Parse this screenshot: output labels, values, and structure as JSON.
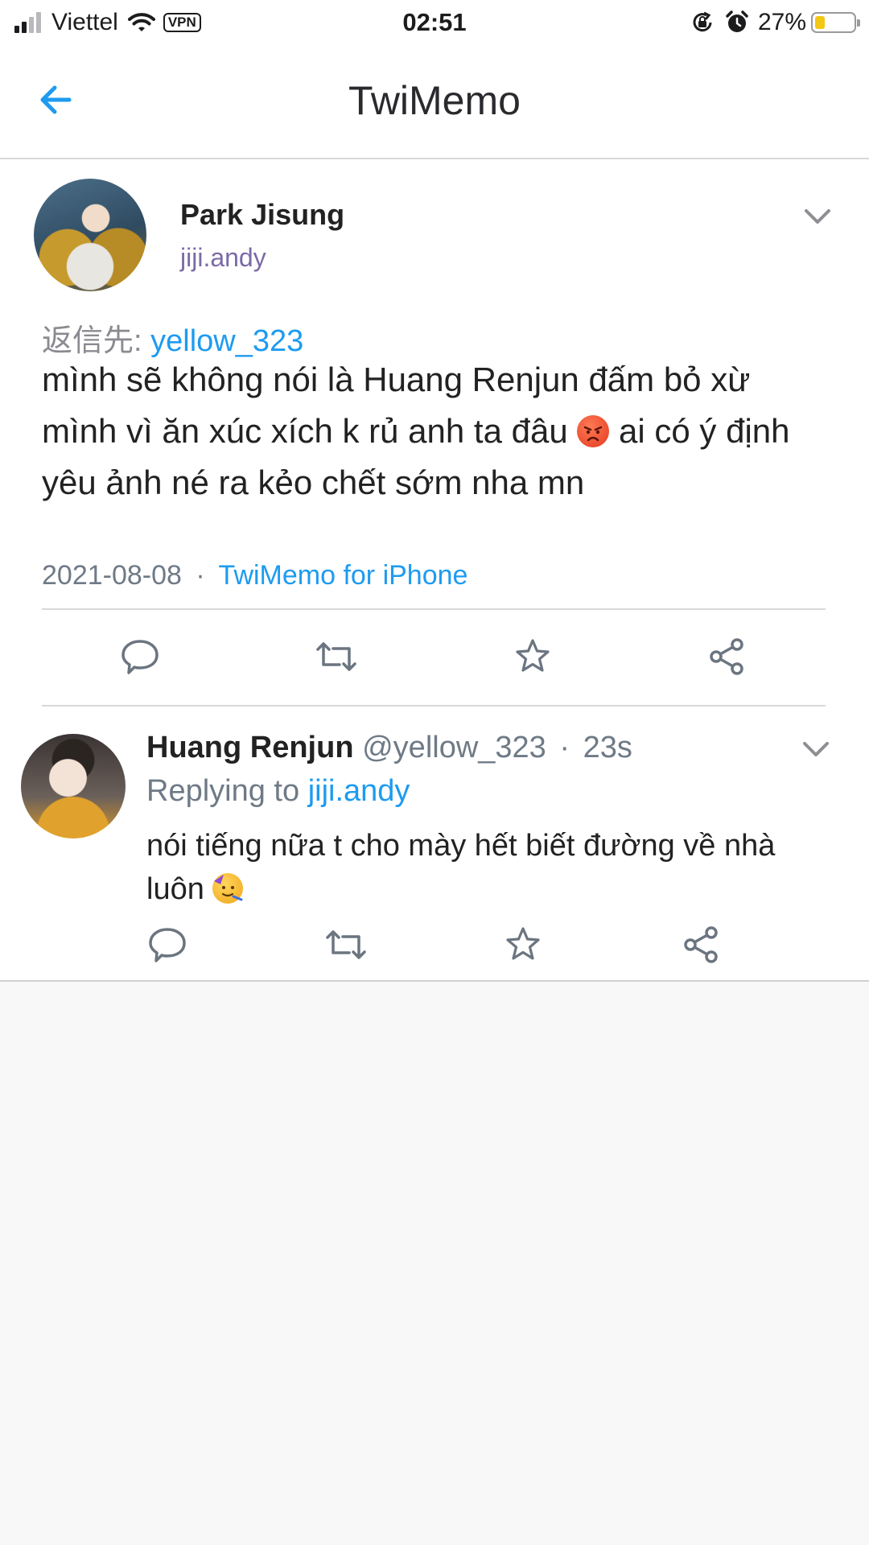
{
  "status_bar": {
    "carrier": "Viettel",
    "vpn": "VPN",
    "time": "02:51",
    "battery_percent": "27%",
    "battery_level": 0.27,
    "icons": [
      "signal-icon",
      "wifi-icon",
      "rotation-lock-icon",
      "alarm-icon",
      "battery-icon"
    ]
  },
  "nav": {
    "title": "TwiMemo",
    "back_icon": "back-arrow-icon",
    "accent_color": "#1d9bf0"
  },
  "main_tweet": {
    "name": "Park Jisung",
    "handle": "jiji.andy",
    "reply_to_label": "返信先:",
    "reply_to_user": "yellow_323",
    "text_before_emoji": "mình sẽ không nói là Huang Renjun đấm bỏ xừ mình vì ăn xúc xích k rủ anh ta đâu",
    "emoji": "angry-face-emoji",
    "text_after_emoji": "ai có ý định yêu ảnh né ra kẻo chết sớm nha mn",
    "date": "2021-08-08",
    "separator": "·",
    "source": "TwiMemo for iPhone",
    "actions": [
      "reply-icon",
      "retweet-icon",
      "favorite-star-icon",
      "share-icon"
    ]
  },
  "reply_tweet": {
    "name": "Huang Renjun",
    "handle": "@yellow_323",
    "separator": "·",
    "time_ago": "23s",
    "replying_label": "Replying to",
    "replying_user": "jiji.andy",
    "text": "nói tiếng nữa t cho mày hết biết đường về nhà luôn",
    "emoji": "partying-face-emoji",
    "actions": [
      "reply-icon",
      "retweet-icon",
      "favorite-star-icon",
      "share-icon"
    ]
  }
}
